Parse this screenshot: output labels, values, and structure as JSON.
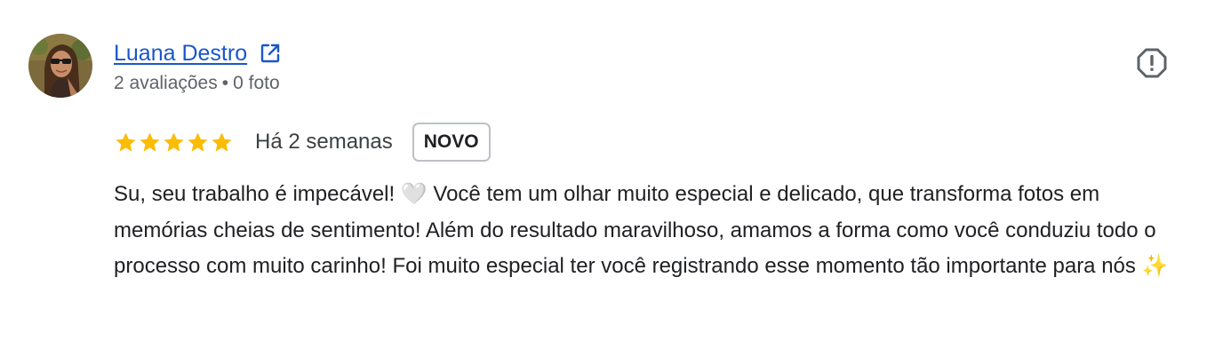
{
  "review": {
    "author": {
      "name": "Luana Destro",
      "reviews_count": "2 avaliações",
      "separator": "•",
      "photos_count": "0 foto"
    },
    "rating": {
      "stars": 5,
      "max": 5,
      "color": "#fbbc04"
    },
    "time": "Há 2 semanas",
    "badge": "NOVO",
    "text": "Su, seu trabalho é impecável! 🤍 Você tem um olhar muito especial e delicado, que transforma fotos em memórias cheias de sentimento! Além do resultado maravilhoso, amamos a forma como você conduziu todo o processo com muito carinho! Foi muito especial ter você registrando esse momento tão importante para nós ✨",
    "icons": {
      "external": "external-link-icon",
      "report": "report-flag-icon",
      "star": "star-icon"
    },
    "colors": {
      "link": "#1a57c9",
      "muted": "#5f6368",
      "text": "#202124"
    }
  }
}
